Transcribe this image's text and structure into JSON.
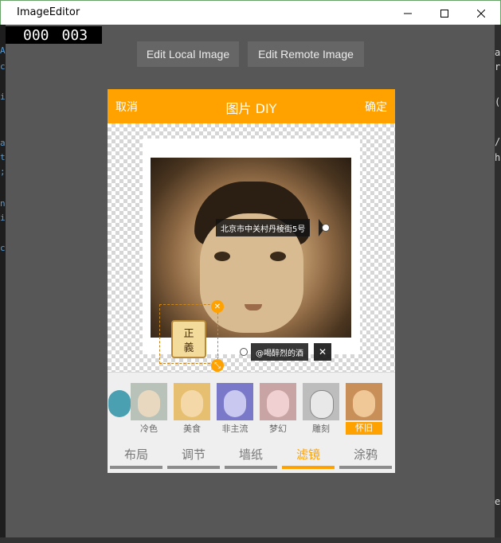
{
  "window": {
    "title": "ImageEditor"
  },
  "fps": {
    "left": "000",
    "right": "003"
  },
  "toolbar": {
    "local_label": "Edit Local Image",
    "remote_label": "Edit Remote Image"
  },
  "editor": {
    "cancel": "取消",
    "title": "图片 DIY",
    "ok": "确定",
    "tag_location": "北京市中关村丹棱街5号",
    "tag_user": "@喝醉烈的酒",
    "sticker_text": [
      "正",
      "義"
    ],
    "accent_color": "#ffa200"
  },
  "filters": [
    {
      "label": "",
      "tint": "#4a9fb0"
    },
    {
      "label": "冷色",
      "tint": "#9aa9a0"
    },
    {
      "label": "美食",
      "tint": "#e0b070"
    },
    {
      "label": "非主流",
      "tint": "#8a88d8"
    },
    {
      "label": "梦幻",
      "tint": "#d8b4b4"
    },
    {
      "label": "雕刻",
      "tint": "#cfcfcf"
    },
    {
      "label": "怀旧",
      "tint": "#d8a060",
      "selected": true
    }
  ],
  "tabs": [
    {
      "label": "布局"
    },
    {
      "label": "调节"
    },
    {
      "label": "墙纸"
    },
    {
      "label": "滤镜",
      "active": true
    },
    {
      "label": "涂鸦"
    }
  ]
}
